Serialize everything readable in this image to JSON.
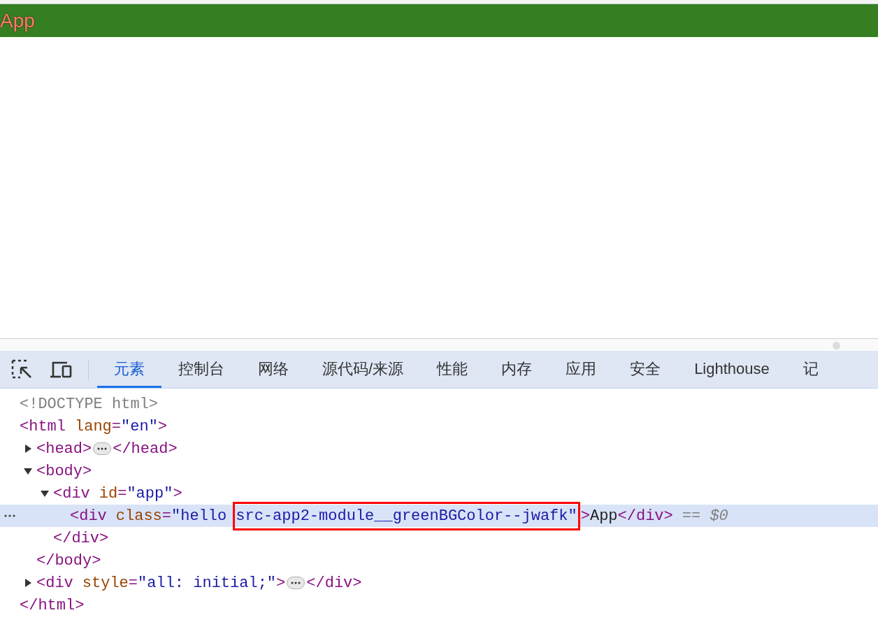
{
  "page": {
    "heading": "App"
  },
  "devtools": {
    "tabs": [
      {
        "label": "元素",
        "selected": true
      },
      {
        "label": "控制台",
        "selected": false
      },
      {
        "label": "网络",
        "selected": false
      },
      {
        "label": "源代码/来源",
        "selected": false
      },
      {
        "label": "性能",
        "selected": false
      },
      {
        "label": "内存",
        "selected": false
      },
      {
        "label": "应用",
        "selected": false
      },
      {
        "label": "安全",
        "selected": false
      },
      {
        "label": "Lighthouse",
        "selected": false
      },
      {
        "label": "记",
        "selected": false
      }
    ],
    "dom_tree": [
      {
        "selected": false,
        "open": [
          {
            "kind": "doctype",
            "text": "<!DOCTYPE html>"
          }
        ]
      },
      {
        "selected": false,
        "open": [
          {
            "kind": "tag",
            "text": "<html"
          },
          {
            "kind": "attr",
            "text": "lang"
          },
          {
            "kind": "tag",
            "text": "="
          },
          {
            "kind": "value",
            "text": "\"en\""
          },
          {
            "kind": "tag",
            "text": ">"
          }
        ],
        "close": [
          {
            "kind": "tag",
            "text": "</html>"
          }
        ],
        "children": [
          {
            "selected": false,
            "expanded": false,
            "open": [
              {
                "kind": "tag",
                "text": "<head>"
              },
              {
                "kind": "collapsed"
              },
              {
                "kind": "tag",
                "text": "</head>"
              }
            ]
          },
          {
            "selected": false,
            "expanded": true,
            "open": [
              {
                "kind": "tag",
                "text": "<body>"
              }
            ],
            "close": [
              {
                "kind": "tag",
                "text": "</body>"
              }
            ],
            "children": [
              {
                "selected": false,
                "expanded": true,
                "open": [
                  {
                    "kind": "tag",
                    "text": "<div"
                  },
                  {
                    "kind": "attr",
                    "text": "id"
                  },
                  {
                    "kind": "tag",
                    "text": "="
                  },
                  {
                    "kind": "value",
                    "text": "\"app\""
                  },
                  {
                    "kind": "tag",
                    "text": ">"
                  }
                ],
                "close": [
                  {
                    "kind": "tag",
                    "text": "</div>"
                  }
                ],
                "children": [
                  {
                    "selected": true,
                    "open": [
                      {
                        "kind": "tag",
                        "text": "<div"
                      },
                      {
                        "kind": "attr",
                        "text": "class"
                      },
                      {
                        "kind": "tag",
                        "text": "="
                      },
                      {
                        "kind": "value",
                        "text": "\"hello"
                      },
                      {
                        "kind": "value",
                        "text": "src-app2-module__greenBGColor--jwafk\"",
                        "highlighted": true
                      },
                      {
                        "kind": "tag",
                        "text": ">"
                      },
                      {
                        "kind": "text",
                        "text": "App"
                      },
                      {
                        "kind": "tag",
                        "text": "</div>"
                      },
                      {
                        "kind": "hint",
                        "text": "== *$0*"
                      }
                    ]
                  }
                ]
              }
            ]
          },
          {
            "selected": false,
            "expanded": false,
            "open": [
              {
                "kind": "tag",
                "text": "<div"
              },
              {
                "kind": "attr",
                "text": "style"
              },
              {
                "kind": "tag",
                "text": "="
              },
              {
                "kind": "value",
                "text": "\"all: initial;\""
              },
              {
                "kind": "tag",
                "text": ">"
              },
              {
                "kind": "collapsed"
              },
              {
                "kind": "tag",
                "text": "</div>"
              }
            ]
          }
        ]
      }
    ]
  }
}
